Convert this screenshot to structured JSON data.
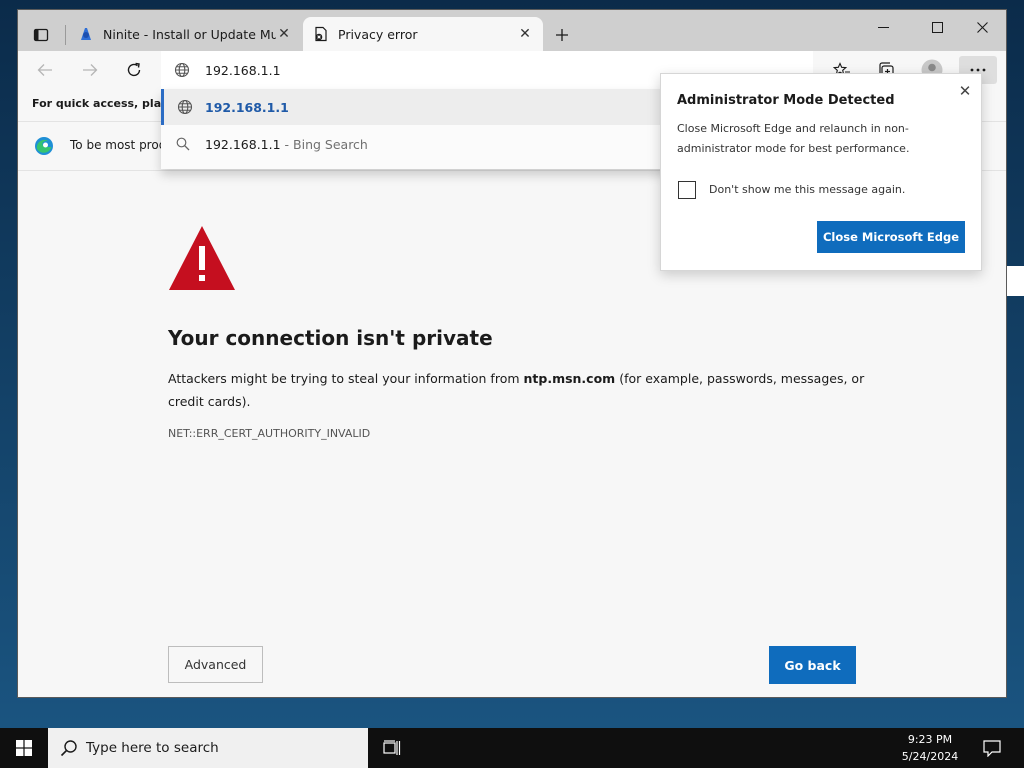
{
  "tabs": [
    {
      "title": "Ninite - Install or Update Multiple Apps at Once",
      "active": false,
      "icon": "ninite-icon"
    },
    {
      "title": "Privacy error",
      "active": true,
      "icon": "privacy-error-icon"
    }
  ],
  "address_bar": {
    "value": "192.168.1.1",
    "suggestions": [
      {
        "text": "192.168.1.1",
        "sub": "",
        "icon": "globe-icon"
      },
      {
        "text": "192.168.1.1",
        "sub": "- Bing Search",
        "icon": "search-icon"
      }
    ]
  },
  "favorites_bar": {
    "text": "For quick access, place y"
  },
  "infobar": {
    "text": "To be most prod"
  },
  "popup": {
    "title": "Administrator Mode Detected",
    "body": "Close Microsoft Edge and relaunch in non-administrator mode for best performance.",
    "checkbox_label": "Don't show me this message again.",
    "checked": false,
    "button": "Close Microsoft Edge"
  },
  "error": {
    "title": "Your connection isn't private",
    "body_prefix": "Attackers might be trying to steal your information from ",
    "host": "ntp.msn.com",
    "body_suffix": " (for example, passwords, messages, or credit cards).",
    "code": "NET::ERR_CERT_AUTHORITY_INVALID",
    "advanced_label": "Advanced",
    "goback_label": "Go back"
  },
  "taskbar": {
    "search_placeholder": "Type here to search",
    "time": "9:23 PM",
    "date": "5/24/2024"
  },
  "colors": {
    "accent": "#0f6cbd",
    "warning_red": "#c50f1f",
    "suggestion_blue": "#1f5aa8"
  }
}
